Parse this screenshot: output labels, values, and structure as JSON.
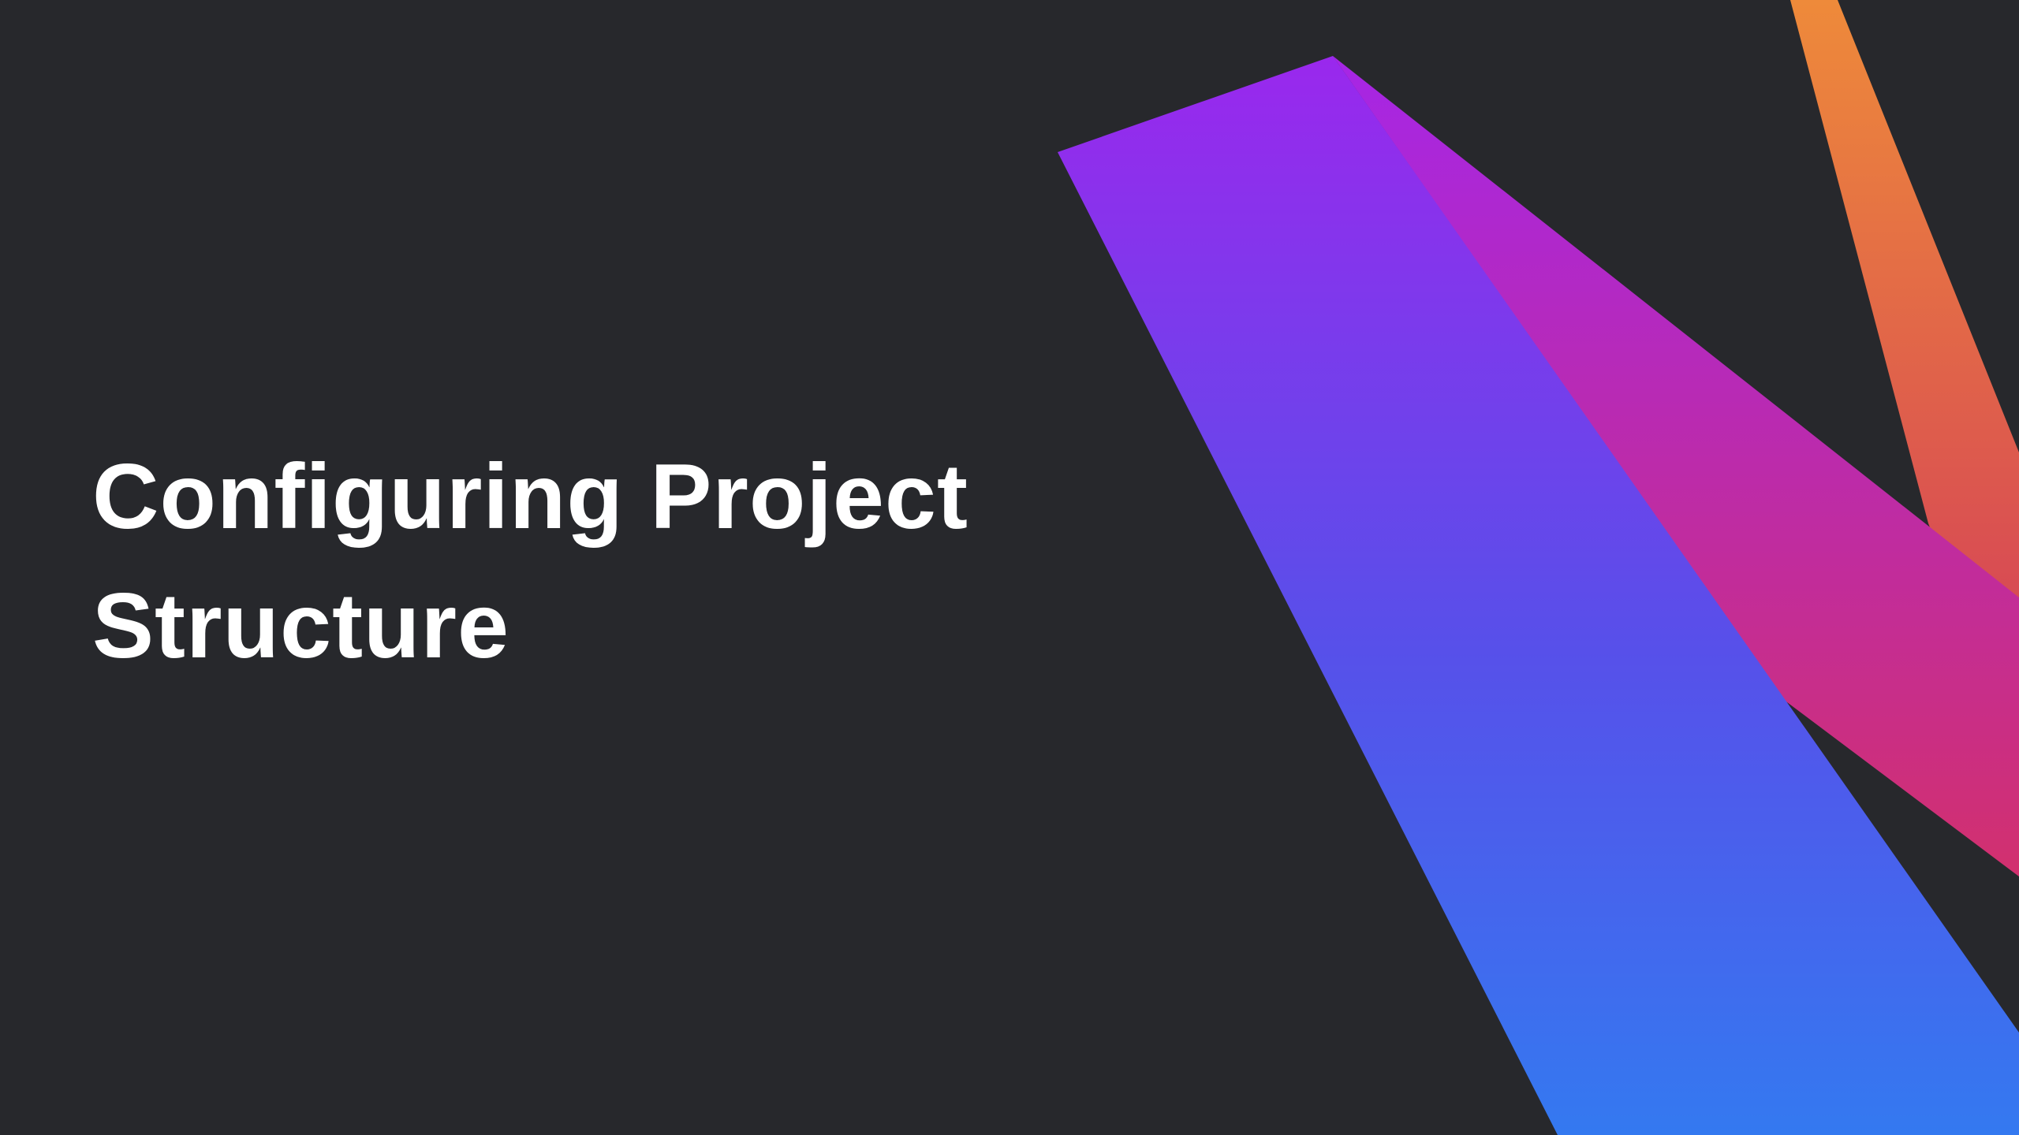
{
  "slide": {
    "title_line_1": "Configuring Project",
    "title_line_2": "Structure",
    "background_color": "#27282c",
    "text_color": "#ffffff",
    "decoration": {
      "icon": "kotlin-style-gradient-shapes",
      "colors": {
        "purple": "#9a2bef",
        "blue": "#3479f0",
        "magenta": "#b82fc8",
        "pink": "#d23268",
        "orange": "#ee8a3a"
      }
    }
  }
}
